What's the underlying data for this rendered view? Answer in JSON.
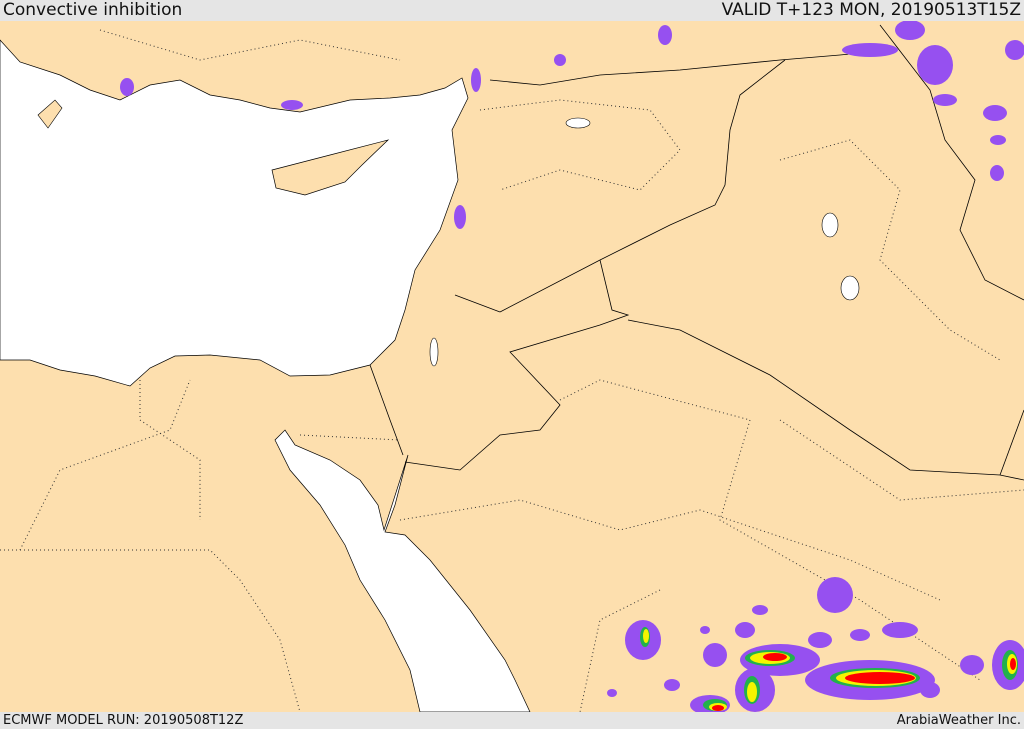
{
  "header": {
    "title": "Convective inhibition",
    "valid": "VALID T+123 MON, 20190513T15Z"
  },
  "footer": {
    "model_run": "ECMWF MODEL RUN: 20190508T12Z",
    "credit": "ArabiaWeather Inc."
  },
  "colors": {
    "land": "#fddfae",
    "sea": "#ffffff",
    "cin_low": "#9650f0",
    "cin_mid1": "#1e9be6",
    "cin_mid2": "#22b14c",
    "cin_mid3": "#f5f500",
    "cin_mid4": "#ff8c00",
    "cin_high": "#ff0000"
  }
}
